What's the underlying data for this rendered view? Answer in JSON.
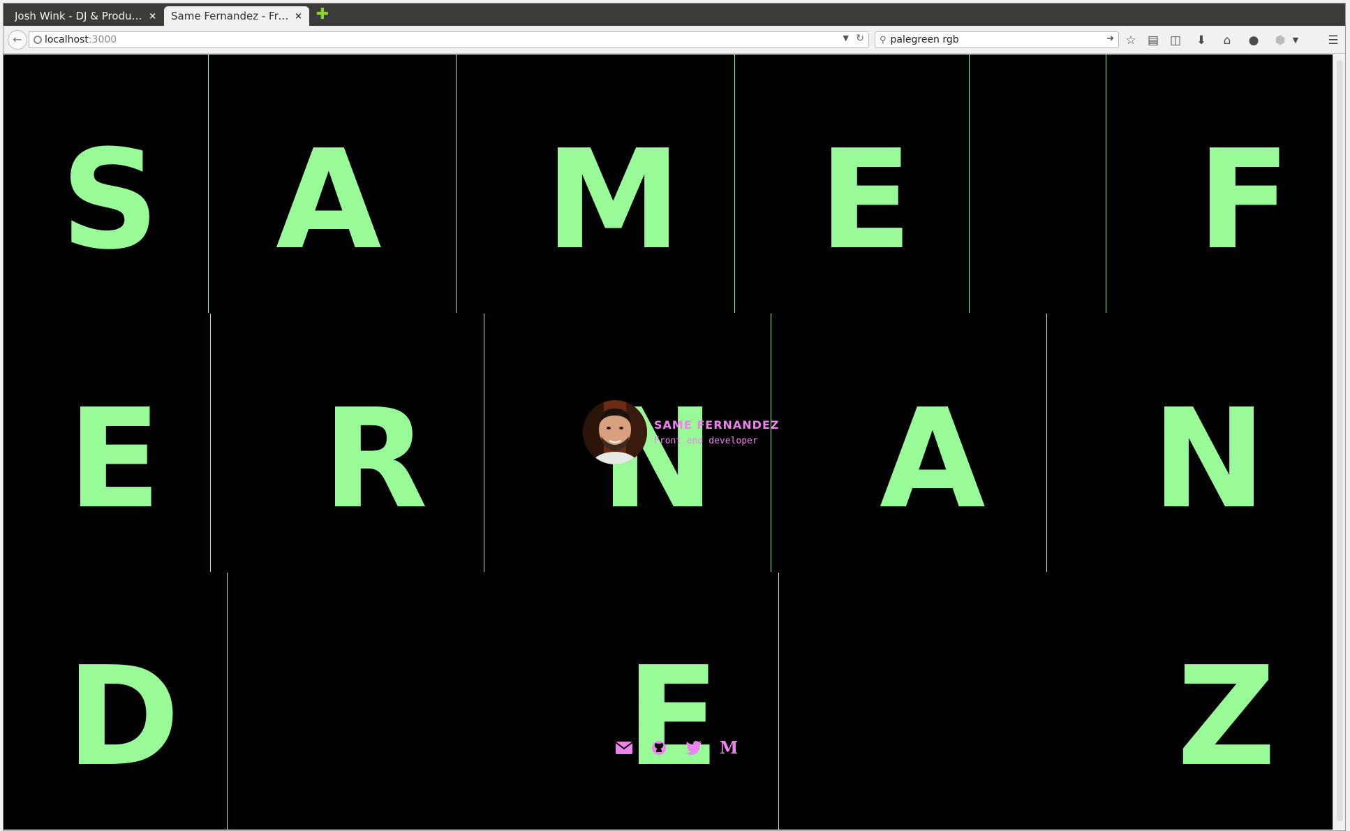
{
  "browser": {
    "tabs": [
      {
        "title": "Josh Wink - DJ & Producer",
        "close": "×"
      },
      {
        "title": "Same Fernandez - Front...",
        "close": "×"
      }
    ],
    "new_tab": "✚",
    "url_host": "localhost",
    "url_port": ":3000",
    "search_value": "palegreen rgb"
  },
  "colors": {
    "letters": "#98fb98",
    "accent": "#ee82ee",
    "background": "#000000"
  },
  "letters": [
    "S",
    "A",
    "M",
    "E",
    "F",
    "E",
    "R",
    "N",
    "A",
    "N",
    "D",
    "E",
    "Z"
  ],
  "profile": {
    "name": "SAME FERNANDEZ",
    "role": "Front end developer"
  },
  "social_icons": [
    "envelope-icon",
    "github-icon",
    "twitter-icon",
    "medium-icon"
  ]
}
